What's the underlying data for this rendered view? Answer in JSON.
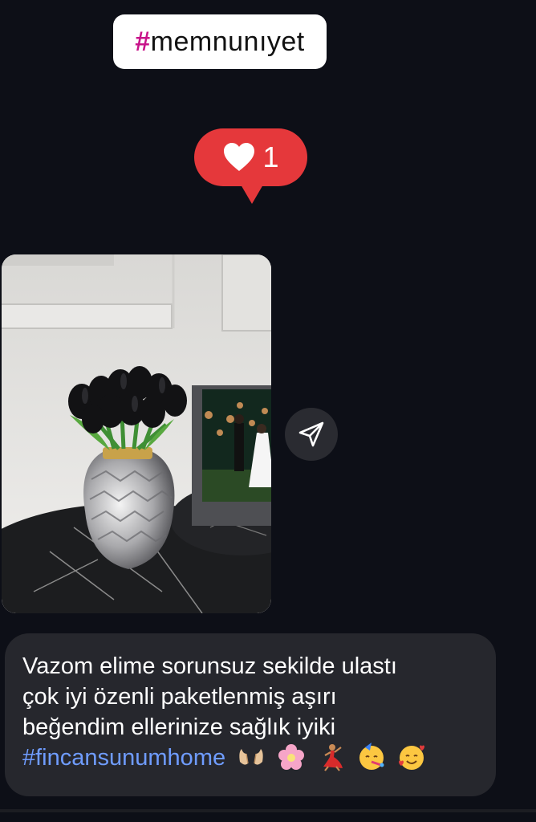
{
  "hashtag_chip": {
    "hash": "#",
    "text": "memnunıyet"
  },
  "like_reaction": {
    "icon": "heart-icon",
    "count": "1",
    "color": "#e5383b"
  },
  "photo": {
    "icon": "photo-thumbnail"
  },
  "share": {
    "icon": "send-icon"
  },
  "message": {
    "lines": [
      "Vazom elime sorunsuz sekilde ulastı",
      "çok iyi özenli paketlenmiş aşırı",
      "beğendim ellerinize sağlık iyiki"
    ],
    "hashtag": "#fincansunumhome",
    "emojis": [
      "palms-up-icon",
      "flower-icon",
      "dancer-icon",
      "party-face-icon",
      "smiling-hearts-face-icon"
    ],
    "link_color": "#6f9cff"
  }
}
